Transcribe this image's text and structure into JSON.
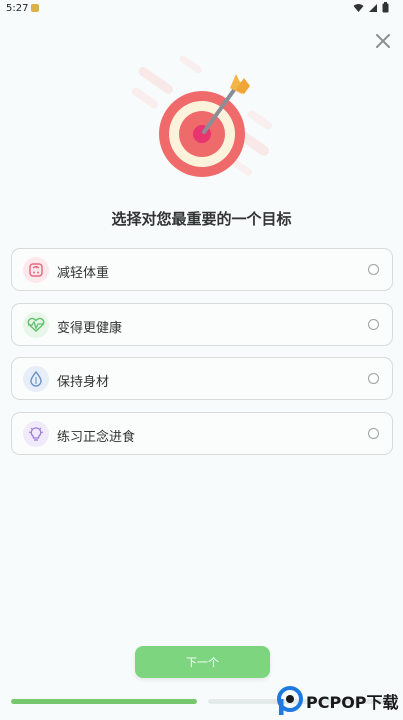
{
  "status_bar": {
    "time": "5:27"
  },
  "header": {
    "close_icon": "close-icon"
  },
  "title": "选择对您最重要的一个目标",
  "options": [
    {
      "label": "减轻体重",
      "icon": "scale-icon",
      "icon_color": "#e56b80",
      "icon_bg": "#fde8ec"
    },
    {
      "label": "变得更健康",
      "icon": "heartbeat-icon",
      "icon_color": "#5fc06b",
      "icon_bg": "#e7f6e8"
    },
    {
      "label": "保持身材",
      "icon": "water-drop-icon",
      "icon_color": "#6b93c8",
      "icon_bg": "#e7eef8"
    },
    {
      "label": "练习正念进食",
      "icon": "lightbulb-icon",
      "icon_color": "#9b7ad6",
      "icon_bg": "#f0eafa"
    }
  ],
  "next_button": "下一个",
  "progress": {
    "value": 0.5
  },
  "watermark": {
    "text": "PCPOP下载"
  },
  "colors": {
    "accent": "#7ed57f",
    "progress": "#77c86c",
    "target_red": "#ef6b6b"
  }
}
